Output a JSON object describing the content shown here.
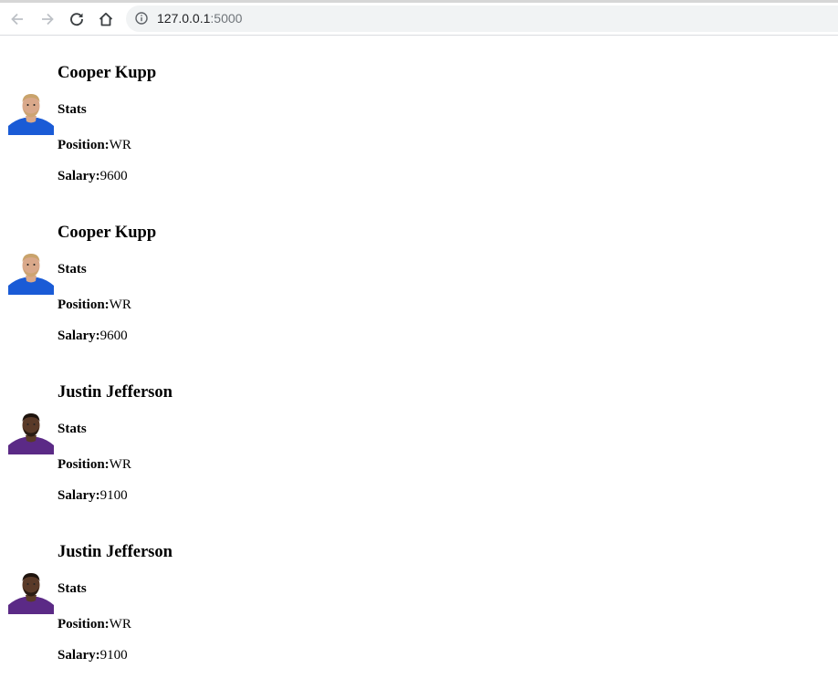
{
  "browser": {
    "url_host": "127.0.0.1",
    "url_port": ":5000"
  },
  "players": [
    {
      "name": "Cooper Kupp",
      "stats_label": "Stats",
      "position_label": "Position:",
      "position": "WR",
      "salary_label": "Salary:",
      "salary": "9600",
      "jersey_color": "#1a5bd6",
      "skin": "#d9a88a",
      "hair": "#c9a36b"
    },
    {
      "name": "Cooper Kupp",
      "stats_label": "Stats",
      "position_label": "Position:",
      "position": "WR",
      "salary_label": "Salary:",
      "salary": "9600",
      "jersey_color": "#1a5bd6",
      "skin": "#d9a88a",
      "hair": "#c9a36b"
    },
    {
      "name": "Justin Jefferson",
      "stats_label": "Stats",
      "position_label": "Position:",
      "position": "WR",
      "salary_label": "Salary:",
      "salary": "9100",
      "jersey_color": "#5b2a86",
      "skin": "#5a3a28",
      "hair": "#1e140e"
    },
    {
      "name": "Justin Jefferson",
      "stats_label": "Stats",
      "position_label": "Position:",
      "position": "WR",
      "salary_label": "Salary:",
      "salary": "9100",
      "jersey_color": "#5b2a86",
      "skin": "#5a3a28",
      "hair": "#1e140e"
    }
  ]
}
